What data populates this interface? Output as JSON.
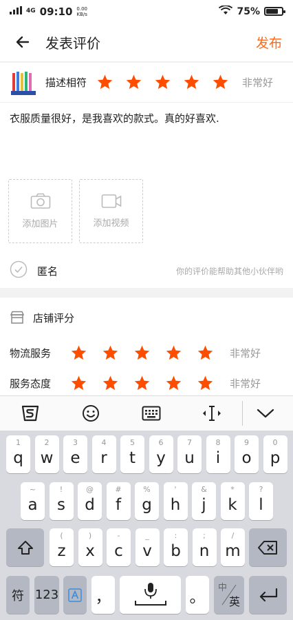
{
  "status": {
    "network": "4G",
    "time": "09:10",
    "speed_value": "0.00",
    "speed_unit": "KB/s",
    "battery": "75%",
    "battery_level": 0.75
  },
  "header": {
    "title": "发表评价",
    "publish_label": "发布"
  },
  "product_rating": {
    "label": "描述相符",
    "stars": 5,
    "rating_text": "非常好"
  },
  "review": {
    "text": "衣服质量很好，是我喜欢的款式。真的好喜欢."
  },
  "media": {
    "add_photo": "添加图片",
    "add_video": "添加视频"
  },
  "anonymous": {
    "label": "匿名",
    "hint": "你的评价能帮助其他小伙伴哟"
  },
  "shop": {
    "title": "店铺评分",
    "rows": [
      {
        "label": "物流服务",
        "stars": 5,
        "rating_text": "非常好"
      },
      {
        "label": "服务态度",
        "stars": 5,
        "rating_text": "非常好"
      }
    ]
  },
  "keyboard": {
    "row1": [
      {
        "sub": "1",
        "main": "q"
      },
      {
        "sub": "2",
        "main": "w"
      },
      {
        "sub": "3",
        "main": "e"
      },
      {
        "sub": "4",
        "main": "r"
      },
      {
        "sub": "5",
        "main": "t"
      },
      {
        "sub": "6",
        "main": "y"
      },
      {
        "sub": "7",
        "main": "u"
      },
      {
        "sub": "8",
        "main": "i"
      },
      {
        "sub": "9",
        "main": "o"
      },
      {
        "sub": "0",
        "main": "p"
      }
    ],
    "row2": [
      {
        "sub": "~",
        "main": "a"
      },
      {
        "sub": "!",
        "main": "s"
      },
      {
        "sub": "@",
        "main": "d"
      },
      {
        "sub": "#",
        "main": "f"
      },
      {
        "sub": "%",
        "main": "g"
      },
      {
        "sub": "'",
        "main": "h"
      },
      {
        "sub": "&",
        "main": "j"
      },
      {
        "sub": "*",
        "main": "k"
      },
      {
        "sub": "?",
        "main": "l"
      }
    ],
    "row3": [
      {
        "sub": "(",
        "main": "z"
      },
      {
        "sub": ")",
        "main": "x"
      },
      {
        "sub": "-",
        "main": "c"
      },
      {
        "sub": "_",
        "main": "v"
      },
      {
        "sub": ":",
        "main": "b"
      },
      {
        "sub": ";",
        "main": "n"
      },
      {
        "sub": "/",
        "main": "m"
      }
    ],
    "symbol_key": "符",
    "number_key": "123",
    "comma_key": "，",
    "period_key": "。",
    "lang_top": "中",
    "lang_bottom": "英"
  },
  "colors": {
    "accent": "#ff6a1a",
    "star": "#ff4d00"
  }
}
